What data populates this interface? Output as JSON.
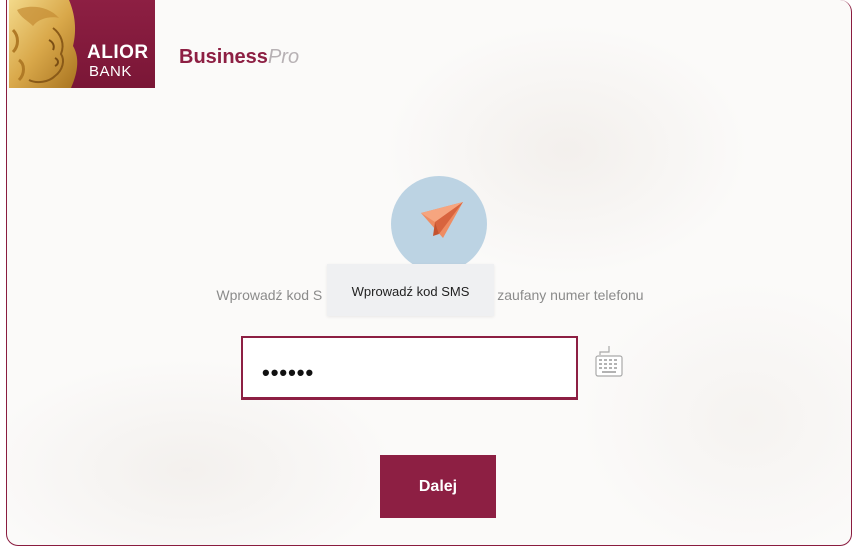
{
  "brand": {
    "bank_line1": "ALIOR",
    "bank_line2": "BANK",
    "product_bold": "Business",
    "product_light": "Pro",
    "brand_color": "#8d1f43",
    "logo_icon": "goddess-head-logo"
  },
  "sms_step": {
    "icon": "paper-plane-icon",
    "icon_circle_color": "#bcd3e3",
    "instruction_start": "Wprowadź kod S",
    "instruction_end": "zaufany numer telefonu",
    "tooltip": "Wprowadź kod SMS",
    "code_value": "••••••",
    "keyboard_icon": "virtual-keyboard-icon",
    "submit_label": "Dalej"
  }
}
